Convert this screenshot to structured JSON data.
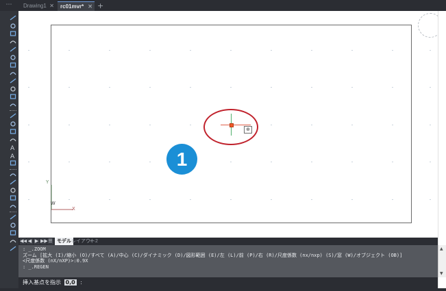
{
  "tabs": {
    "menu_glyph": "⋯",
    "items": [
      {
        "label": "Drawing1",
        "active": false,
        "close": "✕"
      },
      {
        "label": "rc01mvr*",
        "active": true,
        "close": "✕"
      }
    ],
    "add": "+"
  },
  "toolbar": {
    "tools": [
      "line-icon",
      "polyline-icon",
      "circle-icon",
      "arc-icon",
      "rectangle-icon",
      "polygon-icon",
      "hatch-icon",
      "revcloud-icon",
      "spline-icon",
      "ellipse-icon",
      "insert-block-icon",
      "point-icon",
      "table-icon",
      "gradient-icon",
      "region-icon",
      "boundary-icon",
      "multiline-text-icon",
      "text-icon",
      "single-line-text-icon",
      "donut-icon",
      "attribute-icon",
      "wipeout-icon",
      "xline-icon",
      "ray-icon",
      "layer-icon",
      "properties-icon",
      "matchprop-icon",
      "layer-state-icon",
      "layer-prev-icon"
    ]
  },
  "canvas": {
    "badge_number": "1",
    "zoom_cursor_glyph": "⊕",
    "ucs": {
      "y": "Y",
      "x": "X",
      "w": "W"
    },
    "colors": {
      "crosshair_h": "#e0604a",
      "crosshair_v": "#4fae6b",
      "highlight": "#c0212b",
      "badge": "#1b8fd6"
    }
  },
  "layout_tabs": {
    "nav": [
      "◀◀",
      "◀",
      "▶",
      "▶▶"
    ],
    "list_icon": "☰",
    "items": [
      {
        "label": "モデル",
        "active": true
      },
      {
        "label": "レイアウト2",
        "active": false
      }
    ],
    "add": "+"
  },
  "command_history": [
    ":  _.ZOOM",
    "ズーム [拡大 (I)/縮小 (O)/すべて (A)/中心 (C)/ダイナミック (D)/図形範囲 (E)/左 (L)/前 (P)/右 (R)/尺度係数 (nx/nxp) (S)/窓 (W)/オブジェクト (OB)]",
    "<尺度係数 (nX/nXP)>:0.9X",
    ":  _.REGEN"
  ],
  "command_line": {
    "prompt": "挿入基点を指示",
    "value": "0,0",
    "suffix": ":"
  }
}
